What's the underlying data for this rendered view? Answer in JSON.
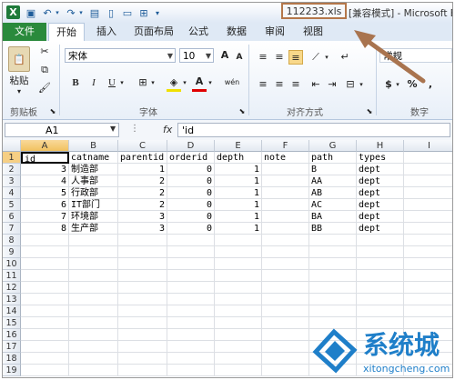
{
  "titlebar": {
    "logo": "X",
    "filename": "112233.xls",
    "title_rest": "[兼容模式] - Microsoft Ex"
  },
  "tabs": {
    "file": "文件",
    "items": [
      "开始",
      "插入",
      "页面布局",
      "公式",
      "数据",
      "审阅",
      "视图"
    ],
    "active": "开始"
  },
  "ribbon": {
    "paste_label": "粘贴",
    "clipboard_label": "剪贴板",
    "font_name": "宋体",
    "font_size": "10",
    "font_label": "字体",
    "align_label": "对齐方式",
    "number_format": "常规",
    "number_label": "数字",
    "bold": "B",
    "italic": "I",
    "underline": "U",
    "font_color_glyph": "A",
    "grow_font": "A",
    "shrink_font": "A",
    "currency": "$",
    "percent": "%",
    "comma": ","
  },
  "formula_bar": {
    "name_box": "A1",
    "fx": "fx",
    "content": "'id"
  },
  "grid": {
    "columns": [
      "A",
      "B",
      "C",
      "D",
      "E",
      "F",
      "G",
      "H",
      "I"
    ],
    "row_numbers": [
      "1",
      "2",
      "3",
      "4",
      "5",
      "6",
      "7",
      "8",
      "9",
      "10",
      "11",
      "12",
      "13",
      "14",
      "15",
      "16",
      "17",
      "18",
      "19"
    ],
    "rows": [
      [
        "id",
        "catname",
        "parentid",
        "orderid",
        "depth",
        "note",
        "path",
        "types"
      ],
      [
        "3",
        "制造部",
        "1",
        "0",
        "1",
        "",
        "B",
        "dept"
      ],
      [
        "4",
        "人事部",
        "2",
        "0",
        "1",
        "",
        "AA",
        "dept"
      ],
      [
        "5",
        "行政部",
        "2",
        "0",
        "1",
        "",
        "AB",
        "dept"
      ],
      [
        "6",
        "IT部门",
        "2",
        "0",
        "1",
        "",
        "AC",
        "dept"
      ],
      [
        "7",
        "环境部",
        "3",
        "0",
        "1",
        "",
        "BA",
        "dept"
      ],
      [
        "8",
        "生产部",
        "3",
        "0",
        "1",
        "",
        "BB",
        "dept"
      ]
    ]
  },
  "watermark": {
    "brand": "系统城",
    "url": "xitongcheng.com"
  },
  "colors": {
    "file_tab": "#2a8a3c",
    "highlight_box": "#b4774a",
    "arrow": "#a9744f",
    "watermark": "#1f7fc9"
  }
}
